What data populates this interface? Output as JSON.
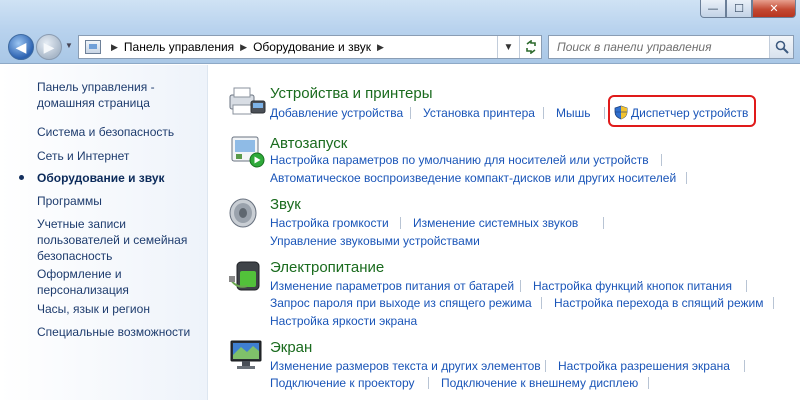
{
  "window": {
    "minimize_icon": "minimize-icon",
    "maximize_icon": "maximize-icon",
    "close_icon": "close-icon"
  },
  "navigation": {
    "back_icon": "arrow-left-icon",
    "forward_icon": "arrow-right-icon"
  },
  "address": {
    "crumbs": [
      "Панель управления",
      "Оборудование и звук"
    ]
  },
  "search": {
    "placeholder": "Поиск в панели управления"
  },
  "sidebar": {
    "items": [
      {
        "label": "Панель управления -"
      },
      {
        "label": "домашняя страница"
      },
      {
        "label": "Система и безопасность"
      },
      {
        "label": "Сеть и Интернет"
      },
      {
        "label": "Оборудование и звук"
      },
      {
        "label": "Программы"
      },
      {
        "label": "Учетные записи"
      },
      {
        "label": "пользователей и семейная"
      },
      {
        "label": "безопасность"
      },
      {
        "label": "Оформление и"
      },
      {
        "label": "персонализация"
      },
      {
        "label": "Часы, язык и регион"
      },
      {
        "label": "Специальные возможности"
      }
    ]
  },
  "categories": [
    {
      "title": "Устройства и принтеры",
      "icon": "printer-icon",
      "links": [
        "Добавление устройства",
        "Установка принтера",
        "Мышь",
        "Диспетчер устройств"
      ]
    },
    {
      "title": "Автозапуск",
      "icon": "autoplay-icon",
      "links": [
        "Настройка параметров по умолчанию для носителей или устройств",
        "Автоматическое воспроизведение компакт-дисков или других носителей"
      ]
    },
    {
      "title": "Звук",
      "icon": "speaker-icon",
      "links": [
        "Настройка громкости",
        "Изменение системных звуков",
        "Управление звуковыми устройствами"
      ]
    },
    {
      "title": "Электропитание",
      "icon": "battery-icon",
      "links": [
        "Изменение параметров питания от батарей",
        "Настройка функций кнопок питания",
        "Запрос пароля при выходе из спящего режима",
        "Настройка перехода в спящий режим",
        "Настройка яркости экрана"
      ]
    },
    {
      "title": "Экран",
      "icon": "monitor-icon",
      "links": [
        "Изменение размеров текста и других элементов",
        "Настройка разрешения экрана",
        "Подключение к проектору",
        "Подключение к внешнему дисплею"
      ]
    }
  ],
  "colors": {
    "category_title": "#1a6b1e",
    "link": "#1a55b8",
    "highlight": "#e01a1a"
  }
}
